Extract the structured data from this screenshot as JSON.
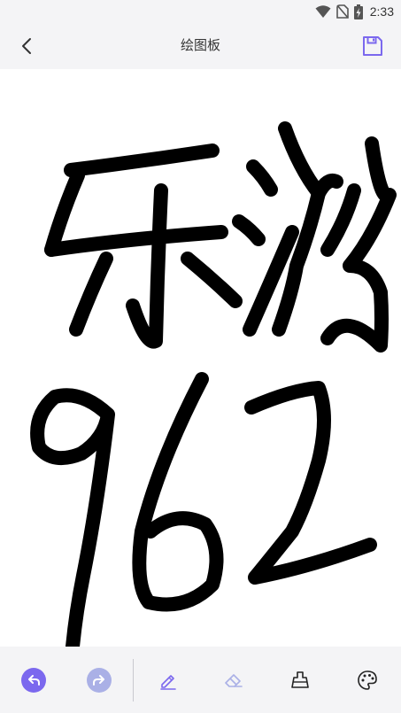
{
  "status_bar": {
    "time": "2:33",
    "icons": [
      "wifi-icon",
      "no-sim-icon",
      "battery-charging-icon"
    ]
  },
  "app_bar": {
    "title": "绘图板",
    "back_icon": "chevron-left-icon",
    "save_icon": "save-icon"
  },
  "canvas": {
    "drawing_text": "乐游962"
  },
  "toolbar": {
    "tools": [
      {
        "name": "undo",
        "icon": "undo-icon",
        "state": "enabled"
      },
      {
        "name": "redo",
        "icon": "redo-icon",
        "state": "disabled"
      },
      {
        "name": "pen",
        "icon": "pencil-icon",
        "state": "selected"
      },
      {
        "name": "eraser",
        "icon": "eraser-icon",
        "state": "disabled"
      },
      {
        "name": "clear",
        "icon": "broom-icon",
        "state": "enabled"
      },
      {
        "name": "color",
        "icon": "palette-icon",
        "state": "enabled"
      }
    ]
  },
  "colors": {
    "accent": "#7b68ee",
    "accent_light": "#aab0e6",
    "stroke": "#000000",
    "background": "#f4f4f6",
    "canvas": "#ffffff"
  }
}
